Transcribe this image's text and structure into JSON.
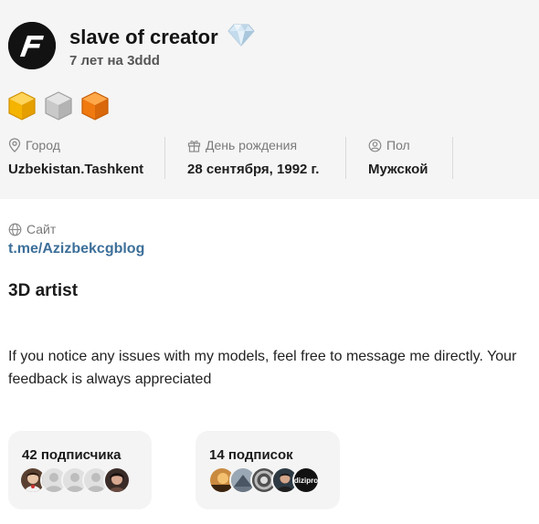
{
  "profile": {
    "username": "slave of creator",
    "membership": "7 лет на 3ddd",
    "avatar_icon": "af-logo-icon",
    "status_icon": "diamond-icon",
    "badges": [
      {
        "icon": "cube-gold-icon",
        "color": "#f5b400"
      },
      {
        "icon": "cube-grey-icon",
        "color": "#c9c9c9"
      },
      {
        "icon": "cube-orange-icon",
        "color": "#f07a10"
      }
    ]
  },
  "info": {
    "city": {
      "label": "Город",
      "value": "Uzbekistan.Tashkent",
      "icon": "location-pin-icon"
    },
    "birthday": {
      "label": "День рождения",
      "value": "28 сентября, 1992 г.",
      "icon": "gift-icon"
    },
    "gender": {
      "label": "Пол",
      "value": "Мужской",
      "icon": "user-circle-icon"
    }
  },
  "site": {
    "label": "Сайт",
    "value": "t.me/Azizbekcgblog",
    "icon": "globe-icon"
  },
  "about": {
    "title": "3D artist",
    "text": "If you notice any issues with my models, feel free to message me directly. Your feedback is always appreciated"
  },
  "followers": {
    "label": "42 подписчика"
  },
  "following": {
    "label": "14 подписок",
    "last_avatar_text": "dizipro"
  },
  "colors": {
    "link": "#3d6f99",
    "panel_bg": "#f5f5f5",
    "card_bg": "#f4f4f4"
  }
}
